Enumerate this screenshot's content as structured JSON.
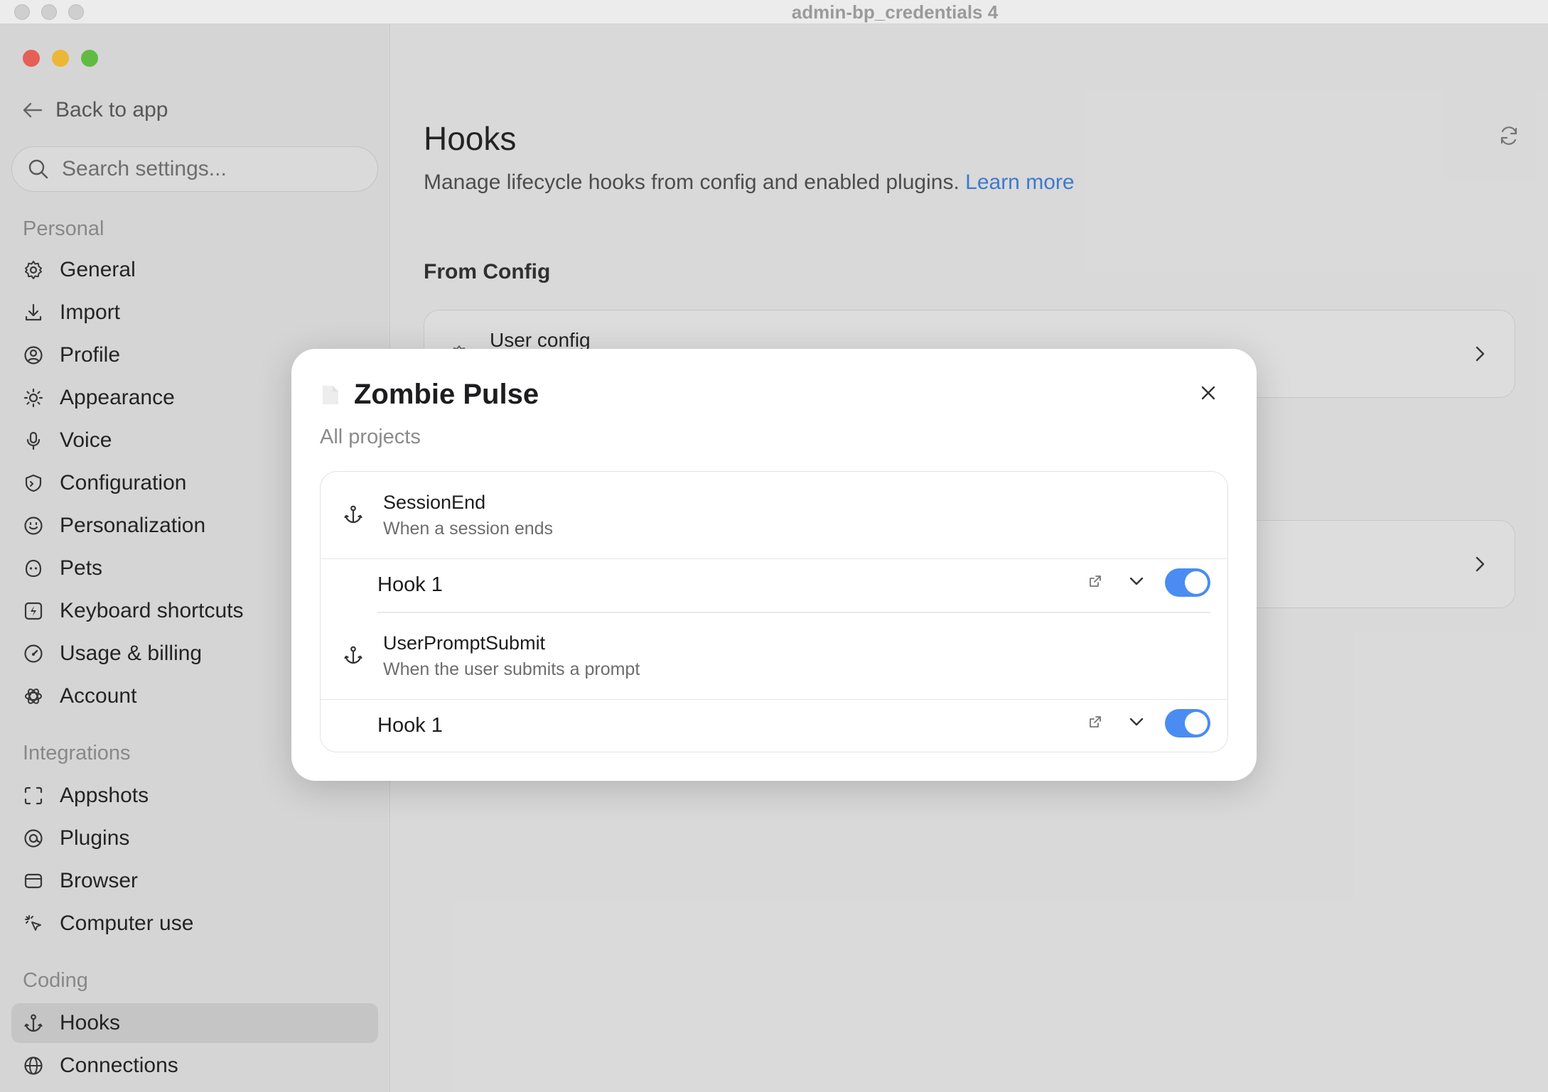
{
  "window": {
    "title": "admin-bp_credentials 4"
  },
  "sidebar": {
    "back_label": "Back to app",
    "search_placeholder": "Search settings...",
    "sections": {
      "personal": "Personal",
      "integrations": "Integrations",
      "coding": "Coding"
    },
    "personal_items": [
      "General",
      "Import",
      "Profile",
      "Appearance",
      "Voice",
      "Configuration",
      "Personalization",
      "Pets",
      "Keyboard shortcuts",
      "Usage & billing",
      "Account"
    ],
    "integration_items": [
      "Appshots",
      "Plugins",
      "Browser",
      "Computer use"
    ],
    "coding_items": [
      "Hooks",
      "Connections"
    ],
    "active_item": "Hooks"
  },
  "main": {
    "title": "Hooks",
    "description": "Manage lifecycle hooks from config and enabled plugins.",
    "learn_more": "Learn more",
    "from_config": "From Config",
    "user_config": "User config"
  },
  "modal": {
    "title": "Zombie Pulse",
    "subtitle": "All projects",
    "events": [
      {
        "name": "SessionEnd",
        "description": "When a session ends",
        "hook": "Hook 1",
        "enabled": true
      },
      {
        "name": "UserPromptSubmit",
        "description": "When the user submits a prompt",
        "hook": "Hook 1",
        "enabled": true
      }
    ]
  },
  "colors": {
    "accent": "#4a8cf2",
    "link": "#3a7bd5",
    "traffic_red": "#ee5f57",
    "traffic_yellow": "#f6bd2f",
    "traffic_green": "#5fc23f"
  }
}
